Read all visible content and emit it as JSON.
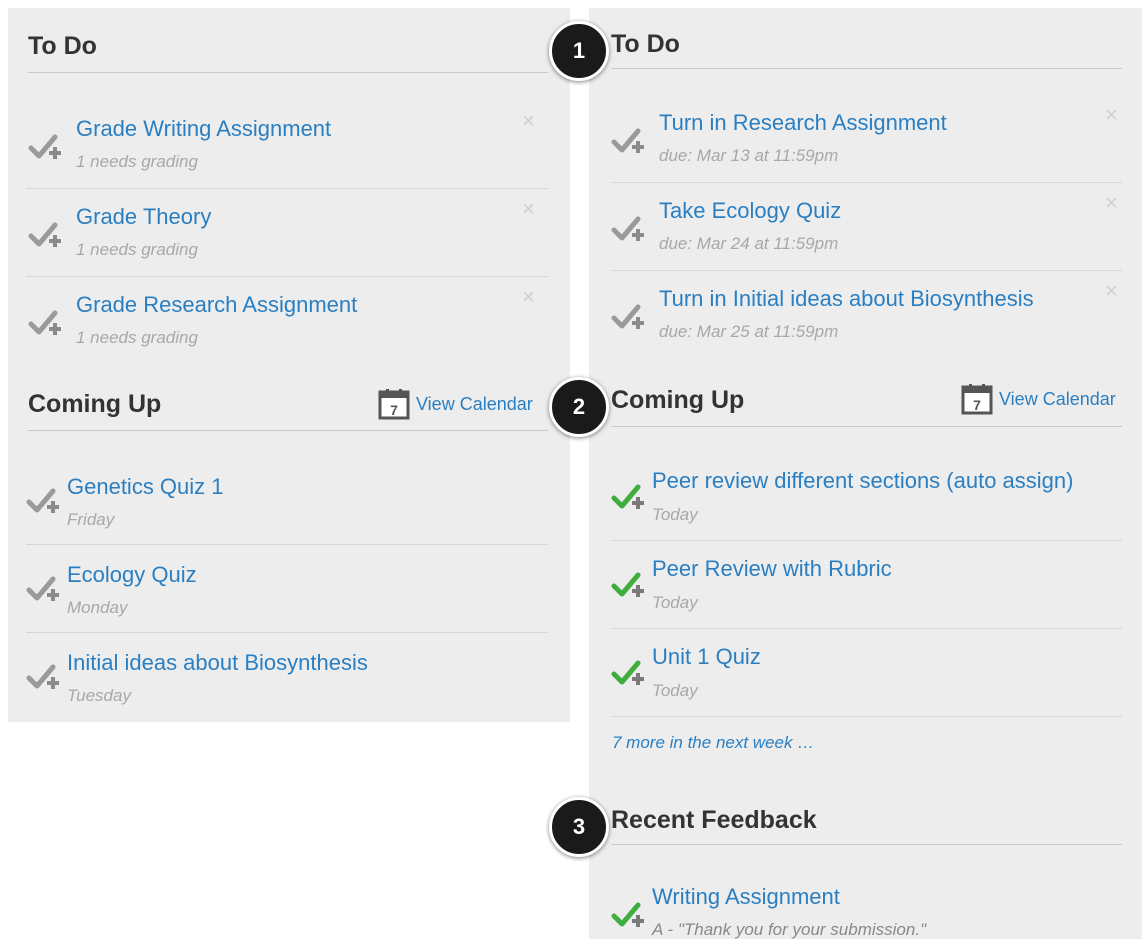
{
  "left": {
    "todo": {
      "heading": "To Do",
      "items": [
        {
          "title": "Grade Writing Assignment",
          "sub": "1 needs grading"
        },
        {
          "title": "Grade Theory",
          "sub": "1 needs grading"
        },
        {
          "title": "Grade Research Assignment",
          "sub": "1 needs grading"
        }
      ]
    },
    "coming_up": {
      "heading": "Coming Up",
      "calendar_link": "View Calendar",
      "calendar_day": "7",
      "items": [
        {
          "title": "Genetics Quiz 1",
          "sub": "Friday"
        },
        {
          "title": "Ecology Quiz",
          "sub": "Monday"
        },
        {
          "title": "Initial ideas about Biosynthesis",
          "sub": "Tuesday"
        }
      ]
    }
  },
  "right": {
    "todo": {
      "heading": "To Do",
      "items": [
        {
          "title": "Turn in Research Assignment",
          "sub": "due: Mar 13 at 11:59pm"
        },
        {
          "title": "Take Ecology Quiz",
          "sub": "due: Mar 24 at 11:59pm"
        },
        {
          "title": "Turn in Initial ideas about Biosynthesis",
          "sub": "due: Mar 25 at 11:59pm"
        }
      ]
    },
    "coming_up": {
      "heading": "Coming Up",
      "calendar_link": "View Calendar",
      "calendar_day": "7",
      "items": [
        {
          "title": "Peer review different sections (auto assign)",
          "sub": "Today"
        },
        {
          "title": "Peer Review with Rubric",
          "sub": "Today"
        },
        {
          "title": "Unit 1 Quiz",
          "sub": "Today"
        }
      ],
      "more_link": "7 more in the next week …"
    },
    "recent_feedback": {
      "heading": "Recent Feedback",
      "items": [
        {
          "title": "Writing Assignment",
          "sub": "A - \"Thank you for your submission.\""
        }
      ]
    }
  },
  "badges": [
    "1",
    "2",
    "3"
  ],
  "icons": {
    "close": "×",
    "check_gray": "check-plus-gray-icon",
    "check_green": "check-plus-green-icon",
    "calendar": "calendar-icon"
  },
  "colors": {
    "link": "#2a7fc2",
    "check_green": "#3fae3f",
    "check_gray": "#9a9a9a",
    "panel_bg": "#ededed"
  }
}
